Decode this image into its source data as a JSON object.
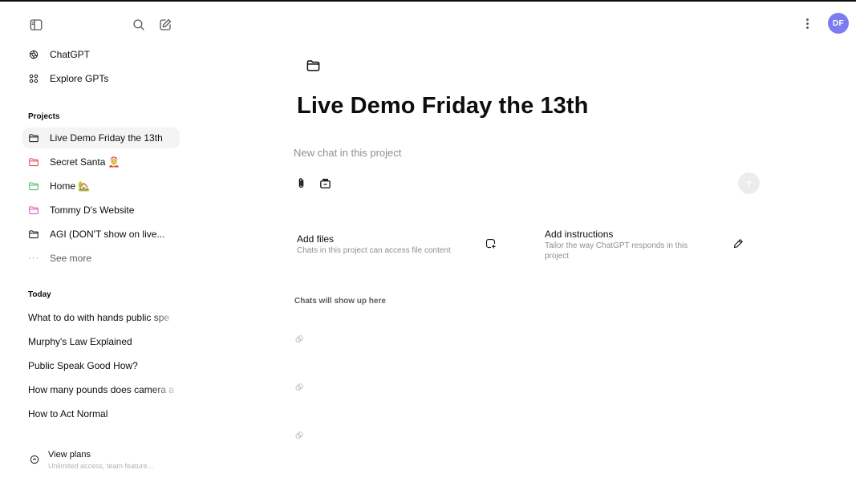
{
  "sidebar": {
    "nav": [
      {
        "label": "ChatGPT",
        "icon": "openai-logo-icon"
      },
      {
        "label": "Explore GPTs",
        "icon": "grid-icon"
      }
    ],
    "projects_label": "Projects",
    "projects": [
      {
        "label": "Live Demo Friday the 13th",
        "color": "#0d0d0d",
        "active": true
      },
      {
        "label": "Secret Santa 🤶",
        "color": "#e0424f",
        "active": false
      },
      {
        "label": "Home 🏡",
        "color": "#3fbf5f",
        "active": false
      },
      {
        "label": "Tommy D's Website",
        "color": "#e14fb4",
        "active": false
      },
      {
        "label": "AGI (DON'T show on live...",
        "color": "#0d0d0d",
        "active": false
      }
    ],
    "see_more": "See more",
    "today_label": "Today",
    "chats": [
      "What to do with hands public spe",
      "Murphy's Law Explained",
      "Public Speak Good How?",
      "How many pounds does camera a",
      "How to Act Normal"
    ],
    "plans": {
      "title": "View plans",
      "subtitle": "Unlimited access, team feature..."
    }
  },
  "header": {
    "avatar_initials": "DF",
    "avatar_color": "#7c7cf0"
  },
  "main": {
    "title": "Live Demo Friday the 13th",
    "composer_placeholder": "New chat in this project",
    "cards": {
      "files": {
        "title": "Add files",
        "description": "Chats in this project can access file content"
      },
      "instructions": {
        "title": "Add instructions",
        "description_line1": "Tailor the way ChatGPT responds in this",
        "description_line2": "project"
      }
    },
    "chats_empty": "Chats will show up here"
  }
}
